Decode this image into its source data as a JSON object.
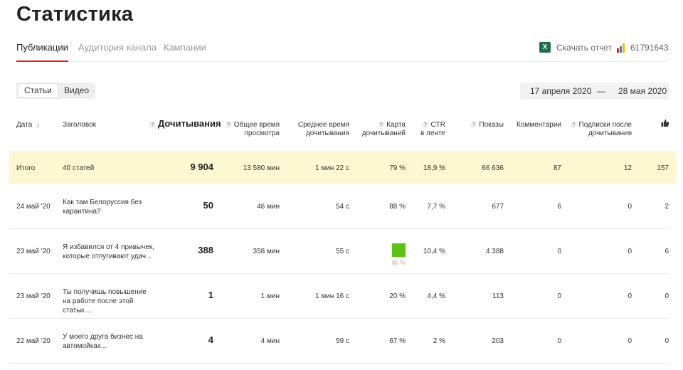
{
  "page": {
    "title": "Статистика"
  },
  "tabs": [
    {
      "label": "Публикации",
      "active": true
    },
    {
      "label": "Аудитория канала",
      "active": false
    },
    {
      "label": "Кампании",
      "active": false
    }
  ],
  "toolbar": {
    "download_label": "Скачать отчет",
    "excel_icon_letter": "X",
    "counter_id": "61791643"
  },
  "segment": {
    "items": [
      "Статьи",
      "Видео"
    ],
    "active": 0
  },
  "date_range": {
    "from": "17 апреля 2020",
    "separator": "—",
    "to": "28 мая 2020"
  },
  "table": {
    "headers": {
      "date": "Дата",
      "sort_arrow": "↓",
      "title": "Заголовок",
      "reads": "Дочитывания",
      "total_time_1": "Общее время",
      "total_time_2": "просмотра",
      "avg_time_1": "Среднее время",
      "avg_time_2": "дочитывания",
      "map_1": "Карта",
      "map_2": "дочитываний",
      "ctr_1": "CTR",
      "ctr_2": "в ленте",
      "views": "Показы",
      "comments": "Комментарии",
      "subs_1": "Подписки после",
      "subs_2": "дочитывания",
      "likes_icon": "thumbs-up-icon",
      "help_icon": "?"
    },
    "total": {
      "date": "Итого",
      "title": "40 статей",
      "reads": "9 904",
      "total_time": "13 580 мин",
      "avg_time": "1 мин 22 с",
      "map": "79 %",
      "ctr": "18,9 %",
      "views": "66 636",
      "comments": "87",
      "subs": "12",
      "likes": "157"
    },
    "rows": [
      {
        "date": "24 май '20",
        "title": "Как там Белоруссия без карантина?",
        "reads": "50",
        "total_time": "46 мин",
        "avg_time": "54 с",
        "map": "88 %",
        "ctr": "7,7 %",
        "views": "677",
        "comments": "6",
        "subs": "0",
        "likes": "2"
      },
      {
        "date": "23 май '20",
        "title": "Я избавился от 4 привычек, которые отпугивают удач...",
        "reads": "388",
        "total_time": "358 мин",
        "avg_time": "55 с",
        "map": "86 %",
        "ctr": "10,4 %",
        "views": "4 388",
        "comments": "0",
        "subs": "0",
        "likes": "6"
      },
      {
        "date": "23 май '20",
        "title": "Ты получишь повышение на работе после этой статьи....",
        "reads": "1",
        "total_time": "1 мин",
        "avg_time": "1 мин 16 с",
        "map": "20 %",
        "ctr": "4,4 %",
        "views": "113",
        "comments": "0",
        "subs": "0",
        "likes": "0"
      },
      {
        "date": "22 май '20",
        "title": "У моего друга бизнес на автомойках...",
        "reads": "4",
        "total_time": "4 мин",
        "avg_time": "59 с",
        "map": "67 %",
        "ctr": "2 %",
        "views": "203",
        "comments": "0",
        "subs": "0",
        "likes": "0"
      }
    ]
  },
  "colors": {
    "accent": "#e0201b",
    "highlight": "#fdf7d2",
    "map_green": "#5cc21a",
    "excel": "#1e7145"
  }
}
